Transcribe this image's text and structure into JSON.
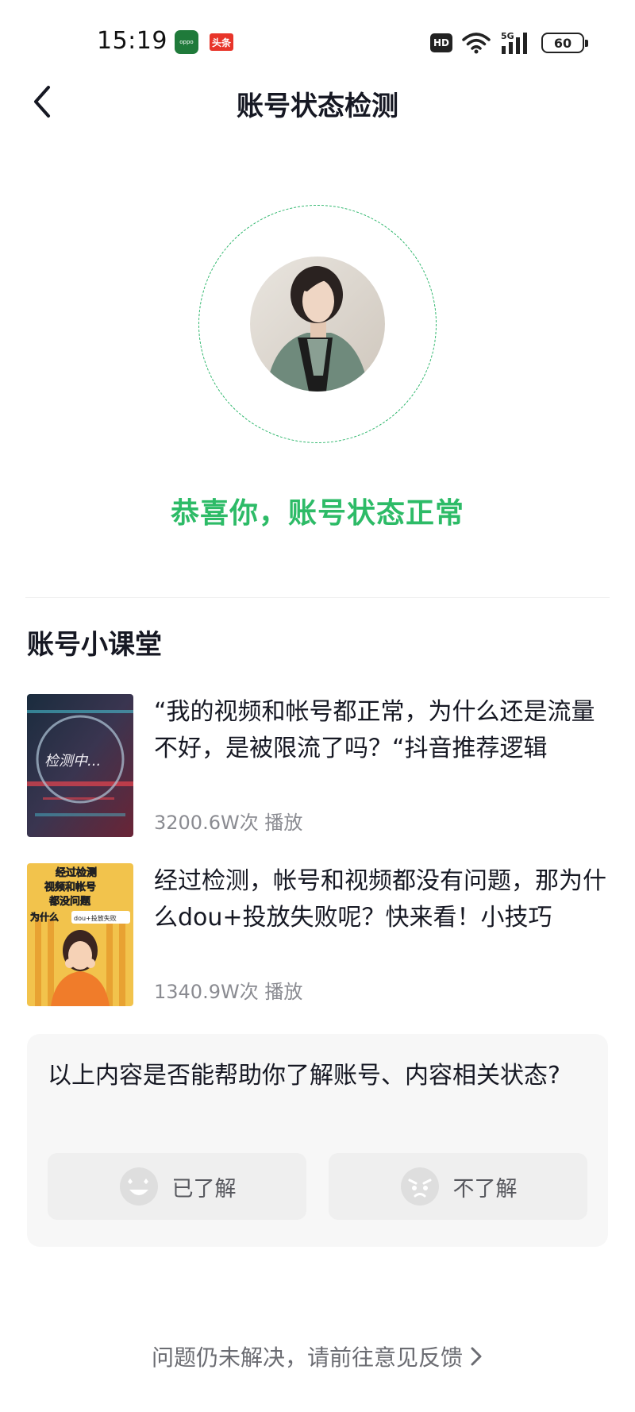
{
  "status_bar": {
    "time": "15:19",
    "oppo_badge": "oppo",
    "toutiao_badge": "头条",
    "hd_label": "HD",
    "network_label": "5G",
    "battery_level": "60"
  },
  "nav": {
    "title": "账号状态检测"
  },
  "result": {
    "message": "恭喜你，账号状态正常",
    "accent_color": "#2dbb67"
  },
  "course": {
    "section_title": "账号小课堂",
    "items": [
      {
        "description": "“我的视频和帐号都正常，为什么还是流量不好，是被限流了吗？“抖音推荐逻辑",
        "plays": "3200.6W次 播放",
        "thumb_text": "检测中..."
      },
      {
        "description": "经过检测，帐号和视频都没有问题，那为什么dou+投放失败呢？快来看！小技巧",
        "plays": "1340.9W次 播放",
        "thumb_text_1": "经过检测",
        "thumb_text_2": "视频和帐号",
        "thumb_text_3": "都没问题",
        "thumb_text_4": "为什么",
        "thumb_text_5": "dou+投放失败"
      }
    ]
  },
  "feedback": {
    "question": "以上内容是否能帮助你了解账号、内容相关状态?",
    "yes_label": "已了解",
    "no_label": "不了解",
    "link_text": "问题仍未解决，请前往意见反馈"
  }
}
